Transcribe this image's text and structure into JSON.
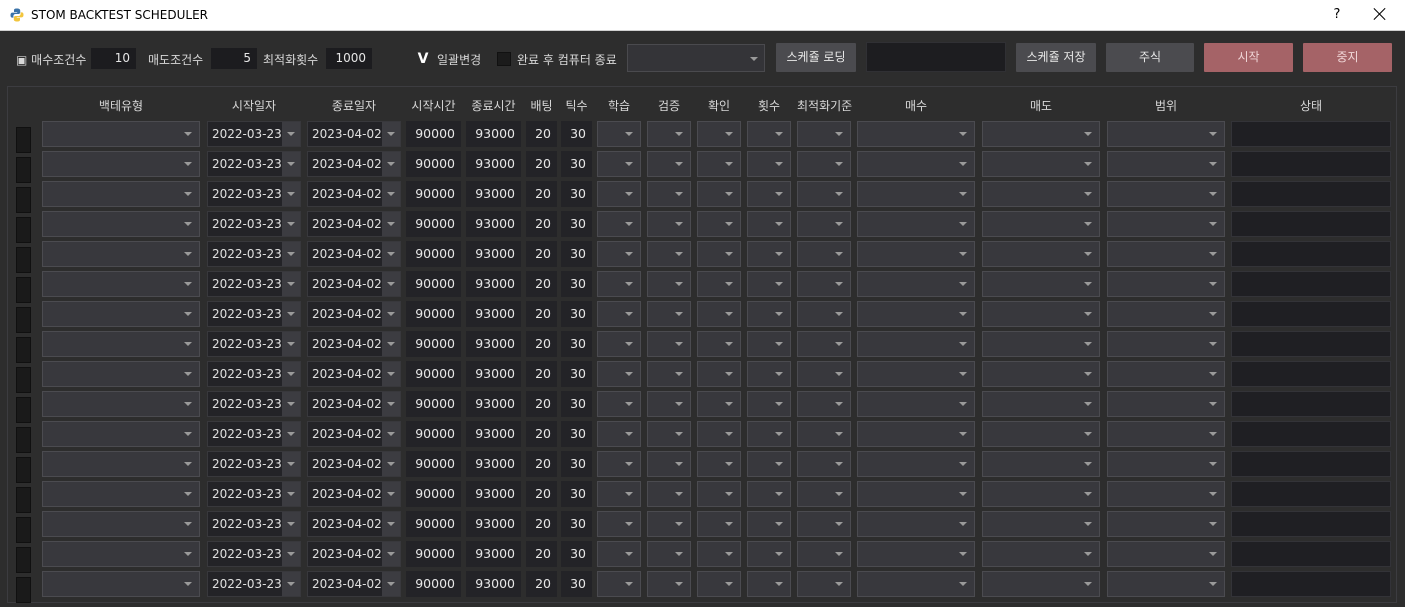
{
  "window": {
    "title": "STOM BACKTEST SCHEDULER",
    "help_label": "?"
  },
  "toolbar": {
    "buy_cond_label": "▣ 매수조건수",
    "buy_cond_value": "10",
    "sell_cond_label": "매도조건수",
    "sell_cond_value": "5",
    "opt_count_label": "최적화횟수",
    "opt_count_value": "1000",
    "bulk_change_checked": true,
    "bulk_change_mark": "V",
    "bulk_change_label": "일괄변경",
    "shutdown_checked": false,
    "shutdown_label": "완료 후 컴퓨터 종료",
    "schedule_select_value": "",
    "schedule_load_label": "스케쥴 로딩",
    "schedule_name_value": "",
    "schedule_save_label": "스케쥴 저장",
    "stock_label": "주식",
    "start_label": "시작",
    "stop_label": "중지"
  },
  "table": {
    "columns": [
      "백테유형",
      "시작일자",
      "종료일자",
      "시작시간",
      "종료시간",
      "배팅",
      "틱수",
      "학습",
      "검증",
      "확인",
      "횟수",
      "최적화기준",
      "매수",
      "매도",
      "범위",
      "상태"
    ],
    "rows": [
      {
        "checked": false,
        "start_date": "2022-03-23 (",
        "end_date": "2023-04-02 (",
        "start_time": "90000",
        "end_time": "93000",
        "betting": "20",
        "ticks": "30"
      },
      {
        "checked": false,
        "start_date": "2022-03-23 (",
        "end_date": "2023-04-02 (",
        "start_time": "90000",
        "end_time": "93000",
        "betting": "20",
        "ticks": "30"
      },
      {
        "checked": false,
        "start_date": "2022-03-23 (",
        "end_date": "2023-04-02 (",
        "start_time": "90000",
        "end_time": "93000",
        "betting": "20",
        "ticks": "30"
      },
      {
        "checked": false,
        "start_date": "2022-03-23 (",
        "end_date": "2023-04-02 (",
        "start_time": "90000",
        "end_time": "93000",
        "betting": "20",
        "ticks": "30"
      },
      {
        "checked": false,
        "start_date": "2022-03-23 (",
        "end_date": "2023-04-02 (",
        "start_time": "90000",
        "end_time": "93000",
        "betting": "20",
        "ticks": "30"
      },
      {
        "checked": false,
        "start_date": "2022-03-23 (",
        "end_date": "2023-04-02 (",
        "start_time": "90000",
        "end_time": "93000",
        "betting": "20",
        "ticks": "30"
      },
      {
        "checked": false,
        "start_date": "2022-03-23 (",
        "end_date": "2023-04-02 (",
        "start_time": "90000",
        "end_time": "93000",
        "betting": "20",
        "ticks": "30"
      },
      {
        "checked": false,
        "start_date": "2022-03-23 (",
        "end_date": "2023-04-02 (",
        "start_time": "90000",
        "end_time": "93000",
        "betting": "20",
        "ticks": "30"
      },
      {
        "checked": false,
        "start_date": "2022-03-23 (",
        "end_date": "2023-04-02 (",
        "start_time": "90000",
        "end_time": "93000",
        "betting": "20",
        "ticks": "30"
      },
      {
        "checked": false,
        "start_date": "2022-03-23 (",
        "end_date": "2023-04-02 (",
        "start_time": "90000",
        "end_time": "93000",
        "betting": "20",
        "ticks": "30"
      },
      {
        "checked": false,
        "start_date": "2022-03-23 (",
        "end_date": "2023-04-02 (",
        "start_time": "90000",
        "end_time": "93000",
        "betting": "20",
        "ticks": "30"
      },
      {
        "checked": false,
        "start_date": "2022-03-23 (",
        "end_date": "2023-04-02 (",
        "start_time": "90000",
        "end_time": "93000",
        "betting": "20",
        "ticks": "30"
      },
      {
        "checked": false,
        "start_date": "2022-03-23 (",
        "end_date": "2023-04-02 (",
        "start_time": "90000",
        "end_time": "93000",
        "betting": "20",
        "ticks": "30"
      },
      {
        "checked": false,
        "start_date": "2022-03-23 (",
        "end_date": "2023-04-02 (",
        "start_time": "90000",
        "end_time": "93000",
        "betting": "20",
        "ticks": "30"
      },
      {
        "checked": false,
        "start_date": "2022-03-23 (",
        "end_date": "2023-04-02 (",
        "start_time": "90000",
        "end_time": "93000",
        "betting": "20",
        "ticks": "30"
      },
      {
        "checked": false,
        "start_date": "2022-03-23 (",
        "end_date": "2023-04-02 (",
        "start_time": "90000",
        "end_time": "93000",
        "betting": "20",
        "ticks": "30"
      }
    ]
  },
  "colors": {
    "background": "#2d2d2d",
    "field": "#232327",
    "combo": "#38383d",
    "button": "#4b4b4f",
    "accent_red": "#a56367"
  },
  "icons": {
    "app": "python-logo-icon",
    "dropdown": "chevron-down-icon",
    "close": "close-icon"
  }
}
